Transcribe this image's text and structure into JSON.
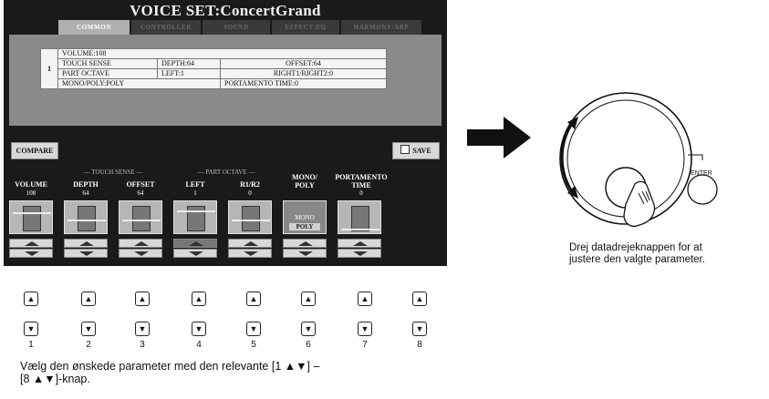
{
  "screen": {
    "title": "VOICE SET:ConcertGrand",
    "tabs": [
      "COMMON",
      "CONTROLLER",
      "SOUND",
      "EFFECT/EQ",
      "HARMONY/ARP"
    ],
    "active_tab": "COMMON",
    "row_number": "1",
    "grid": {
      "volume": "VOLUME:108",
      "touch_sense": "TOUCH SENSE",
      "depth": "DEPTH:64",
      "offset": "OFFSET:64",
      "part_octave": "PART OCTAVE",
      "left": "LEFT:1",
      "right": "RIGHT1/RIGHT2:0",
      "mono_poly": "MONO/POLY:POLY",
      "portamento": "PORTAMENTO TIME:0"
    },
    "compare_label": "COMPARE",
    "save_label": "SAVE",
    "save_icon": "disk-icon",
    "section_touch": "TOUCH SENSE",
    "section_octave": "PART OCTAVE",
    "params": [
      {
        "label": "VOLUME",
        "value": "108"
      },
      {
        "label": "DEPTH",
        "value": "64"
      },
      {
        "label": "OFFSET",
        "value": "64"
      },
      {
        "label": "LEFT",
        "value": "1"
      },
      {
        "label": "R1/R2",
        "value": "0"
      },
      {
        "label": "MONO/",
        "label2": "POLY",
        "value": ""
      },
      {
        "label": "PORTAMENTO",
        "label2": "TIME",
        "value": "0"
      }
    ],
    "mono_option": "MONO",
    "poly_option": "POLY"
  },
  "buttons": {
    "up_glyph": "▲",
    "down_glyph": "▼",
    "numbers": [
      "1",
      "2",
      "3",
      "4",
      "5",
      "6",
      "7",
      "8"
    ],
    "caption_line1": "Vælg den ønskede parameter med den relevante [1 ▲▼] –",
    "caption_line2": "[8 ▲▼]-knap."
  },
  "dial": {
    "enter_label": "ENTER",
    "caption_line1": "Drej datadrejeknappen for at",
    "caption_line2": "justere den valgte parameter."
  },
  "colors": {
    "lcd_background": "#1a1a1a",
    "panel_gray": "#8a8a8a",
    "arrow_black": "#111111"
  }
}
